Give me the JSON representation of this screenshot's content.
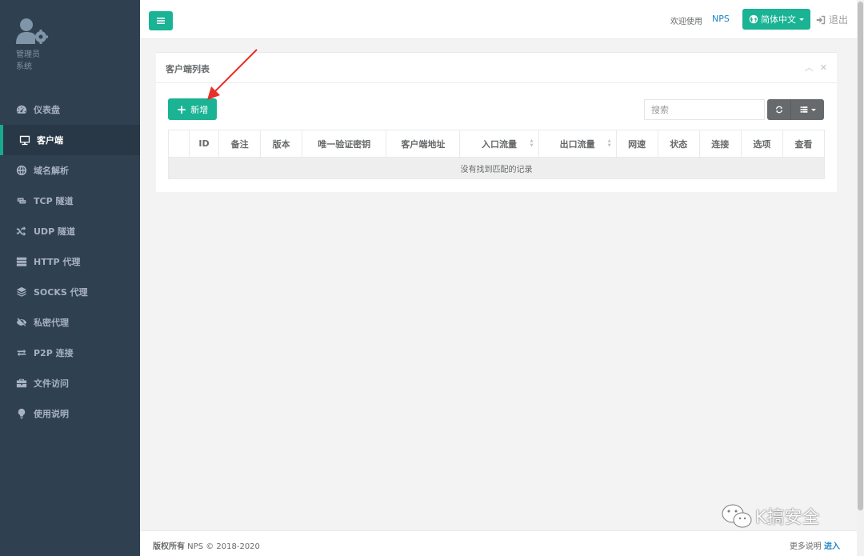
{
  "sidebar": {
    "profile": {
      "name": "管理员",
      "role": "系统"
    },
    "items": [
      {
        "label": "仪表盘",
        "icon": "dashboard-icon"
      },
      {
        "label": "客户端",
        "icon": "monitor-icon",
        "active": true
      },
      {
        "label": "域名解析",
        "icon": "globe-icon"
      },
      {
        "label": "TCP 隧道",
        "icon": "retweet-icon"
      },
      {
        "label": "UDP 隧道",
        "icon": "random-icon"
      },
      {
        "label": "HTTP 代理",
        "icon": "server-icon"
      },
      {
        "label": "SOCKS 代理",
        "icon": "layers-icon"
      },
      {
        "label": "私密代理",
        "icon": "eye-slash-icon"
      },
      {
        "label": "P2P 连接",
        "icon": "exchange-icon"
      },
      {
        "label": "文件访问",
        "icon": "briefcase-icon"
      },
      {
        "label": "使用说明",
        "icon": "lightbulb-icon"
      }
    ]
  },
  "topbar": {
    "welcome": "欢迎使用",
    "brand": "NPS",
    "language": "简体中文",
    "logout": "退出"
  },
  "panel": {
    "title": "客户端列表",
    "add_label": "新增",
    "search_placeholder": "搜索",
    "columns": [
      "",
      "ID",
      "备注",
      "版本",
      "唯一验证密钥",
      "客户端地址",
      "入口流量",
      "出口流量",
      "网速",
      "状态",
      "连接",
      "选项",
      "查看"
    ],
    "empty_message": "没有找到匹配的记录"
  },
  "footer": {
    "copyright_bold": "版权所有",
    "copyright_rest": " NPS © 2018-2020",
    "more_text": "更多说明 ",
    "more_link": "进入"
  },
  "watermark": {
    "text": "K搞安全"
  },
  "colors": {
    "sidebar": "#2f4050",
    "accent": "#1ab394",
    "link": "#1c84c6",
    "arrow": "#e8302a"
  }
}
